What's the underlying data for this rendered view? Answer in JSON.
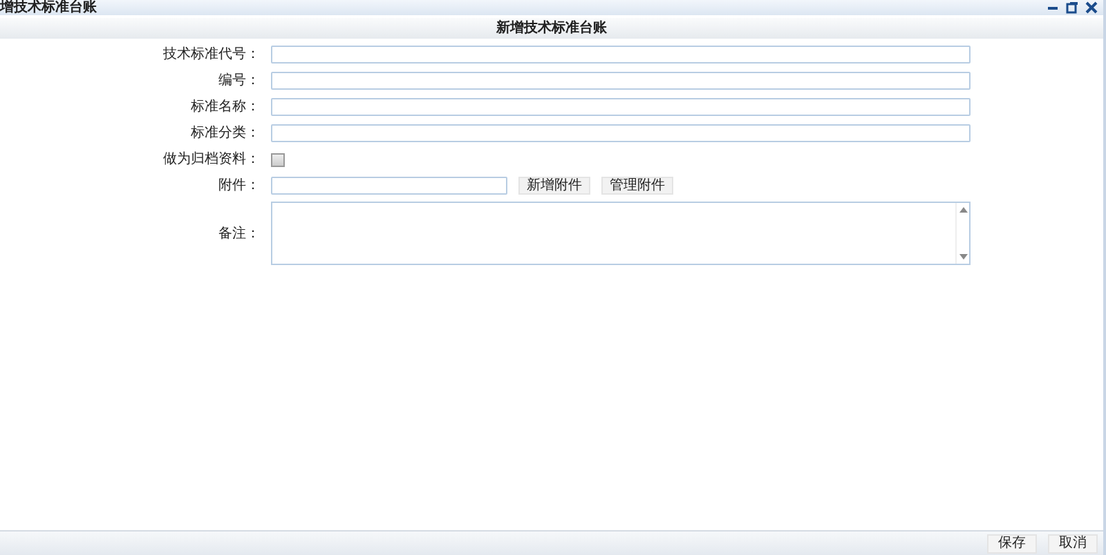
{
  "window": {
    "title": "增技术标准台账"
  },
  "form": {
    "title": "新增技术标准台账",
    "fields": [
      {
        "kind": "text",
        "label": "技术标准代号："
      },
      {
        "kind": "text",
        "label": "编号："
      },
      {
        "kind": "text",
        "label": "标准名称："
      },
      {
        "kind": "text",
        "label": "标准分类："
      },
      {
        "kind": "checkbox",
        "label": "做为归档资料：",
        "checked": false
      },
      {
        "kind": "attachment",
        "label": "附件：",
        "buttons": [
          "新增附件",
          "管理附件"
        ]
      },
      {
        "kind": "textarea",
        "label": "备注："
      }
    ]
  },
  "footer": {
    "buttons": [
      "保存",
      "取消"
    ]
  }
}
